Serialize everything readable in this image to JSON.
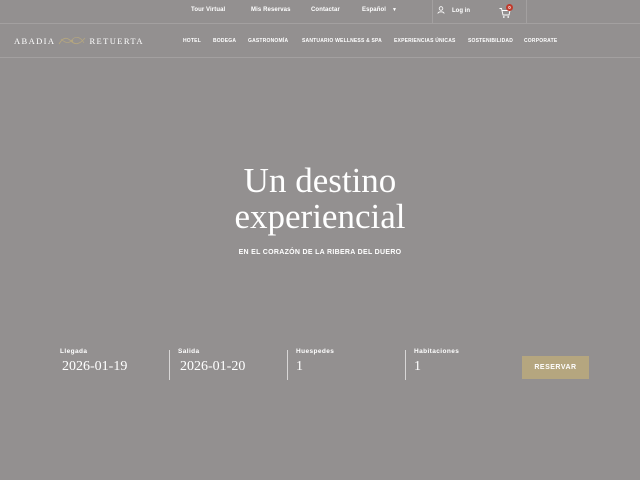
{
  "topbar": {
    "links": [
      "Tour Virtual",
      "Mis Reservas",
      "Contactar"
    ],
    "language": "Español",
    "login_label": "Log in",
    "cart_count": "0"
  },
  "brand": {
    "name_left": "ABADIA",
    "name_right": "RETUERTA",
    "accent_color": "#b5a67f"
  },
  "nav": {
    "items": [
      "HOTEL",
      "BODEGA",
      "GASTRONOMÍA",
      "SANTUARIO WELLNESS & SPA",
      "EXPERIENCIAS ÚNICAS",
      "SOSTENIBILIDAD",
      "CORPORATE"
    ]
  },
  "hero": {
    "title_line1": "Un destino",
    "title_line2": "experiencial",
    "subtitle": "EN EL CORAZÓN DE LA RIBERA DEL DUERO"
  },
  "booking": {
    "arrival_label": "Llegada",
    "arrival_value": "2026-01-19",
    "departure_label": "Salida",
    "departure_value": "2026-01-20",
    "guests_label": "Huespedes",
    "guests_value": "1",
    "rooms_label": "Habitaciones",
    "rooms_value": "1",
    "reserve_label": "RESERVAR"
  },
  "icons": {
    "user": "user-icon",
    "cart": "cart-icon",
    "caret": "chevron-down-icon"
  }
}
